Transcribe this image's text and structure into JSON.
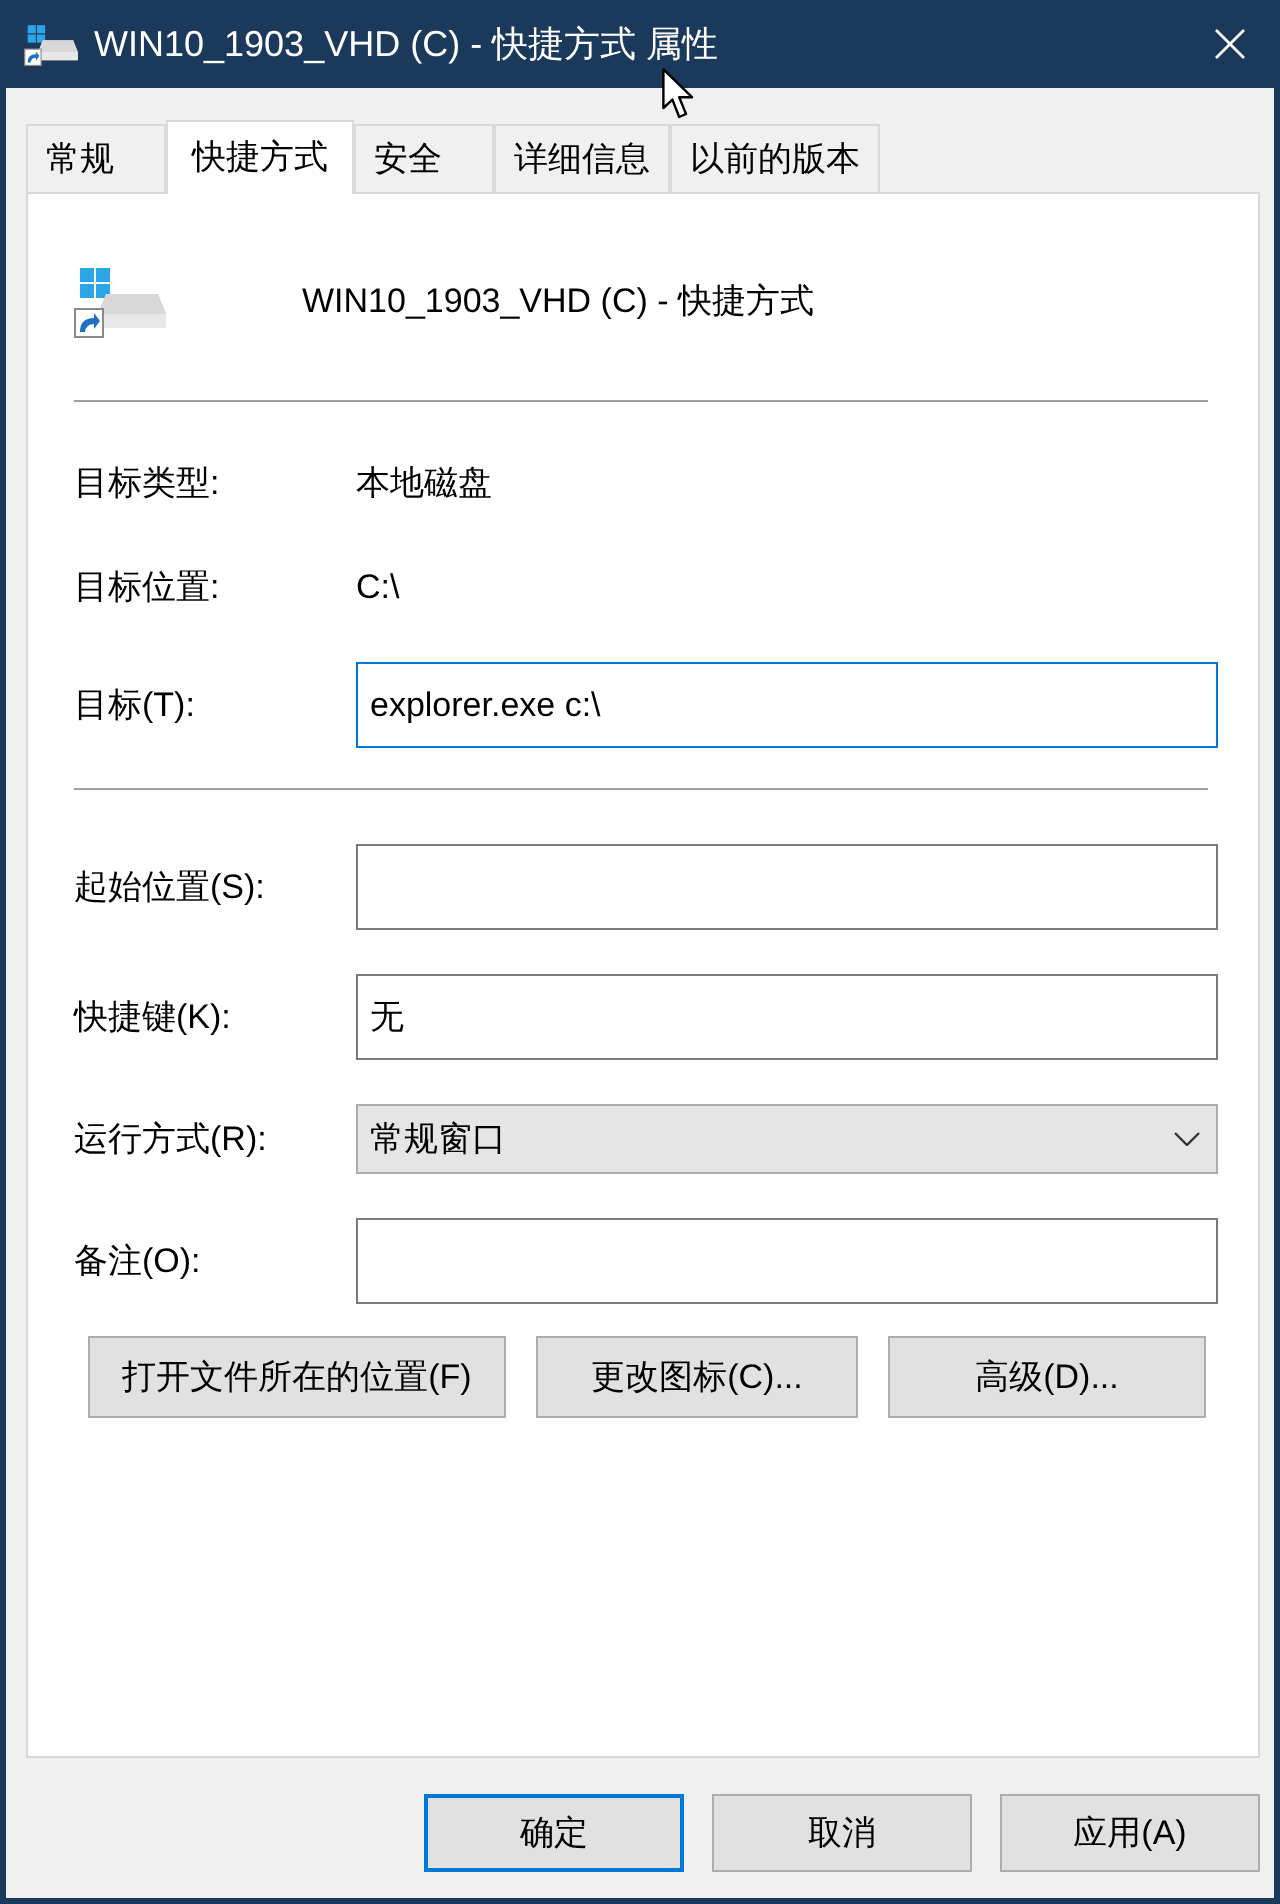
{
  "window": {
    "title": "WIN10_1903_VHD (C) - 快捷方式 属性"
  },
  "tabs": [
    {
      "label": "常规",
      "selected": false
    },
    {
      "label": "快捷方式",
      "selected": true
    },
    {
      "label": "安全",
      "selected": false
    },
    {
      "label": "详细信息",
      "selected": false
    },
    {
      "label": "以前的版本",
      "selected": false
    }
  ],
  "header": {
    "name": "WIN10_1903_VHD (C) - 快捷方式"
  },
  "details": [
    {
      "kind": "static",
      "label": "目标类型:",
      "value": "本地磁盘"
    },
    {
      "kind": "static",
      "label": "目标位置:",
      "value": "C:\\"
    },
    {
      "kind": "text",
      "label": "目标(T):",
      "value": "explorer.exe c:\\",
      "focused": true
    }
  ],
  "settings": [
    {
      "kind": "text",
      "label": "起始位置(S):",
      "focused": false
    },
    {
      "kind": "text",
      "label": "快捷键(K):",
      "value": "无",
      "focused": false
    },
    {
      "kind": "select",
      "label": "运行方式(R):",
      "value": "常规窗口",
      "focused": false
    },
    {
      "kind": "text",
      "label": "备注(O):",
      "focused": false
    }
  ],
  "actions": [
    "打开文件所在的位置(F)",
    "更改图标(C)...",
    "高级(D)..."
  ],
  "dialog_buttons": [
    {
      "label": "确定",
      "default": true
    },
    {
      "label": "取消",
      "default": false
    },
    {
      "label": "应用(A)",
      "default": false
    }
  ]
}
